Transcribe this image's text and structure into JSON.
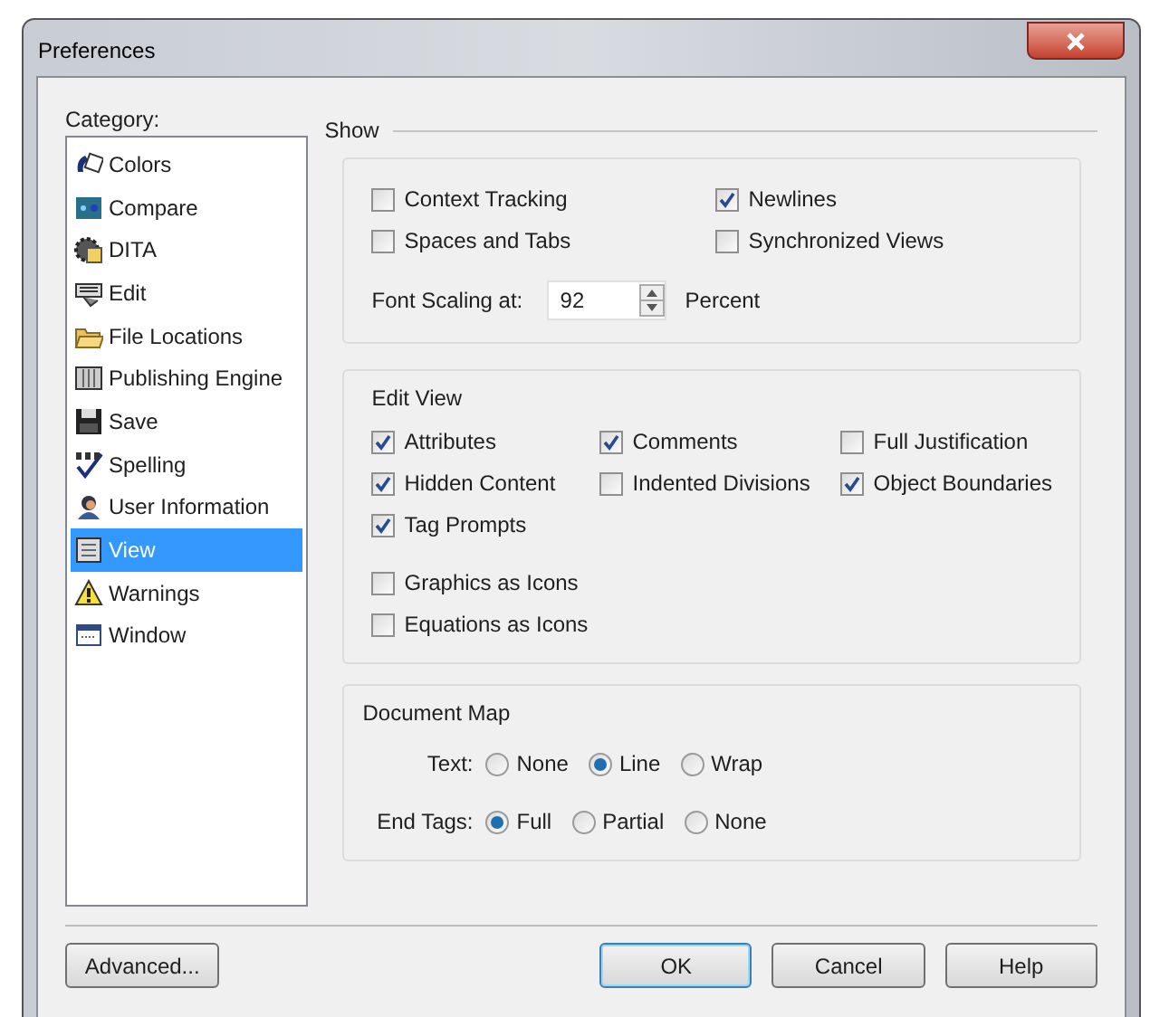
{
  "window": {
    "title": "Preferences"
  },
  "category": {
    "label": "Category:",
    "items": [
      {
        "label": "Colors",
        "selected": false
      },
      {
        "label": "Compare",
        "selected": false
      },
      {
        "label": "DITA",
        "selected": false
      },
      {
        "label": "Edit",
        "selected": false
      },
      {
        "label": "File Locations",
        "selected": false
      },
      {
        "label": "Publishing Engine",
        "selected": false
      },
      {
        "label": "Save",
        "selected": false
      },
      {
        "label": "Spelling",
        "selected": false
      },
      {
        "label": "User Information",
        "selected": false
      },
      {
        "label": "View",
        "selected": true
      },
      {
        "label": "Warnings",
        "selected": false
      },
      {
        "label": "Window",
        "selected": false
      }
    ]
  },
  "show": {
    "title": "Show",
    "checkboxes": [
      {
        "label": "Context Tracking",
        "checked": false
      },
      {
        "label": "Newlines",
        "checked": true
      },
      {
        "label": "Spaces and Tabs",
        "checked": false
      },
      {
        "label": "Synchronized Views",
        "checked": false
      }
    ],
    "font_scaling": {
      "label": "Font Scaling at:",
      "value": "92",
      "unit": "Percent"
    }
  },
  "edit_view": {
    "title": "Edit View",
    "checkboxes": [
      {
        "label": "Attributes",
        "checked": true
      },
      {
        "label": "Comments",
        "checked": true
      },
      {
        "label": "Full Justification",
        "checked": false
      },
      {
        "label": "Hidden Content",
        "checked": true
      },
      {
        "label": "Indented Divisions",
        "checked": false
      },
      {
        "label": "Object Boundaries",
        "checked": true
      },
      {
        "label": "Tag Prompts",
        "checked": true
      }
    ],
    "extra_checkboxes": [
      {
        "label": "Graphics as Icons",
        "checked": false
      },
      {
        "label": "Equations as Icons",
        "checked": false
      }
    ]
  },
  "document_map": {
    "title": "Document Map",
    "groups": [
      {
        "label": "Text:",
        "options": [
          {
            "label": "None",
            "selected": false
          },
          {
            "label": "Line",
            "selected": true
          },
          {
            "label": "Wrap",
            "selected": false
          }
        ]
      },
      {
        "label": "End Tags:",
        "options": [
          {
            "label": "Full",
            "selected": true
          },
          {
            "label": "Partial",
            "selected": false
          },
          {
            "label": "None",
            "selected": false
          }
        ]
      }
    ]
  },
  "buttons": [
    {
      "label": "Advanced...",
      "kind": "secondary"
    },
    {
      "label": "OK",
      "kind": "default"
    },
    {
      "label": "Cancel",
      "kind": "normal"
    },
    {
      "label": "Help",
      "kind": "normal"
    }
  ]
}
